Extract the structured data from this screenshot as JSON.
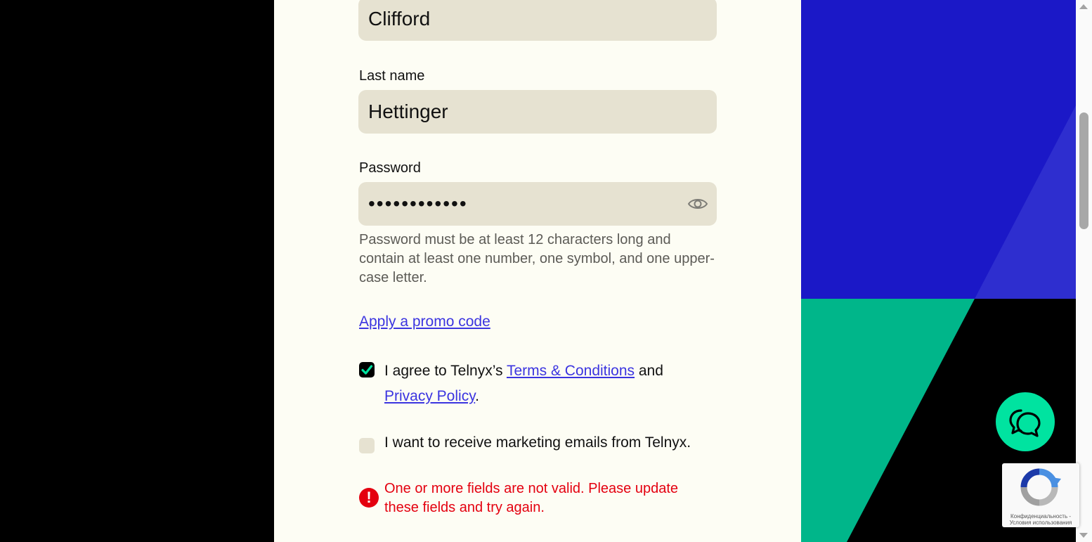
{
  "form": {
    "first_name_value": "Clifford",
    "last_name_label": "Last name",
    "last_name_value": "Hettinger",
    "password_label": "Password",
    "password_masked": "••••••••••••",
    "password_help": "Password must be at least 12 characters long and contain at least one number, one symbol, and one upper-case letter.",
    "promo_link": "Apply a promo code",
    "terms": {
      "prefix": "I agree to Telnyx’s ",
      "terms_link": "Terms & Conditions",
      "middle": " and",
      "privacy_link": "Privacy Policy",
      "suffix": "."
    },
    "marketing_label": "I want to receive marketing emails from Telnyx.",
    "error_icon": "!",
    "error_message": "One or more fields are not valid. Please update these fields and try again."
  },
  "recaptcha": {
    "text": "Конфиденциальность - Условия использования"
  },
  "colors": {
    "panel_bg": "#fdfdf4",
    "field_bg": "#e6e2d1",
    "link": "#3b34e0",
    "error": "#e4000f",
    "accent_green": "#00e3a0",
    "art_blue": "#1b18c7",
    "art_green": "#00b68a"
  },
  "icons": {
    "password_toggle": "eye-icon",
    "terms_checkbox": "checkmark-icon",
    "error": "exclamation-icon",
    "chat": "chat-bubbles-icon",
    "recaptcha": "recaptcha-logo-icon"
  }
}
